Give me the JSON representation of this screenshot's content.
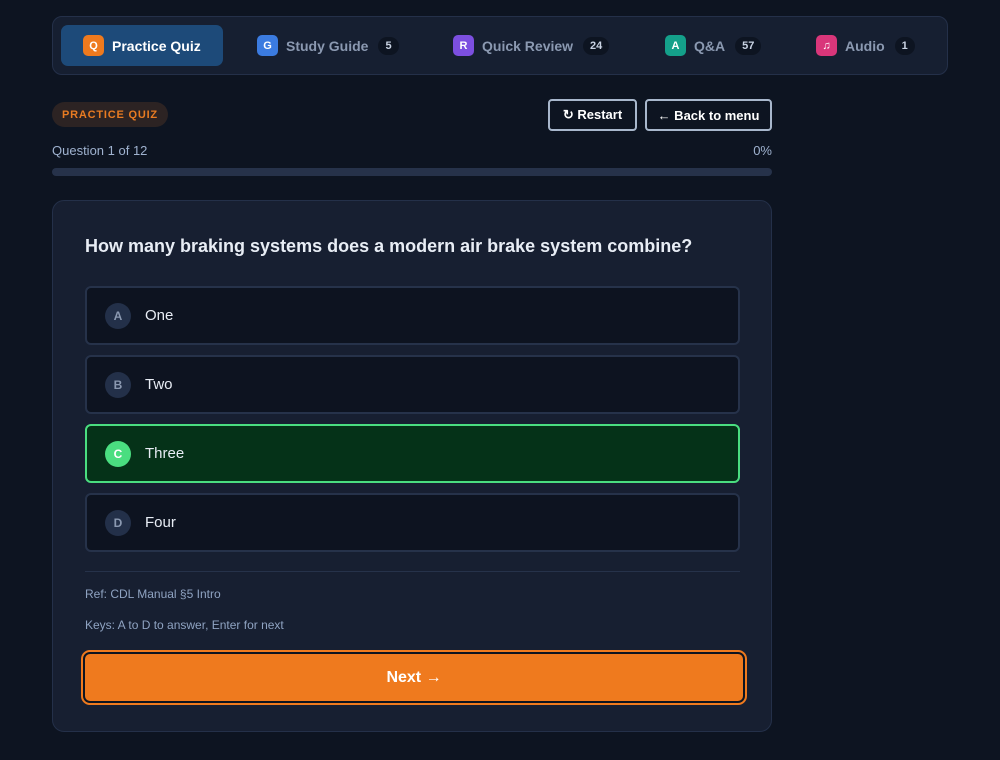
{
  "tabs": [
    {
      "icon_letter": "Q",
      "label": "Practice Quiz",
      "count": "",
      "color": "#ef7a1e",
      "active": true
    },
    {
      "icon_letter": "G",
      "label": "Study Guide",
      "count": "5",
      "color": "#3b7be0"
    },
    {
      "icon_letter": "R",
      "label": "Quick Review",
      "count": "24",
      "color": "#7c4fe0"
    },
    {
      "icon_letter": "A",
      "label": "Q&A",
      "count": "57",
      "color": "#14a08a"
    },
    {
      "icon_letter": "♫",
      "icon": "music-note-icon",
      "label": "Audio",
      "count": "1",
      "color": "#d9367a"
    }
  ],
  "header": {
    "mode_badge": "PRACTICE QUIZ",
    "restart_label": "↻ Restart",
    "back_label": "← Back to menu"
  },
  "progress": {
    "question_label": "Question 1 of 12",
    "percent_label": "0%",
    "percent_value": 0
  },
  "quiz": {
    "question": "How many braking systems does a modern air brake system combine?",
    "options": [
      {
        "letter": "A",
        "text": "One"
      },
      {
        "letter": "B",
        "text": "Two"
      },
      {
        "letter": "C",
        "text": "Three",
        "selected": true
      },
      {
        "letter": "D",
        "text": "Four"
      }
    ],
    "reference": "Ref: CDL Manual §5 Intro",
    "keys_hint": "Keys: A to D to answer, Enter for next",
    "next_label": "Next →"
  },
  "colors": {
    "accent": "#ef7a1e",
    "selected_border": "#4ade80",
    "selected_bg": "#053218",
    "background": "#0d1421"
  }
}
